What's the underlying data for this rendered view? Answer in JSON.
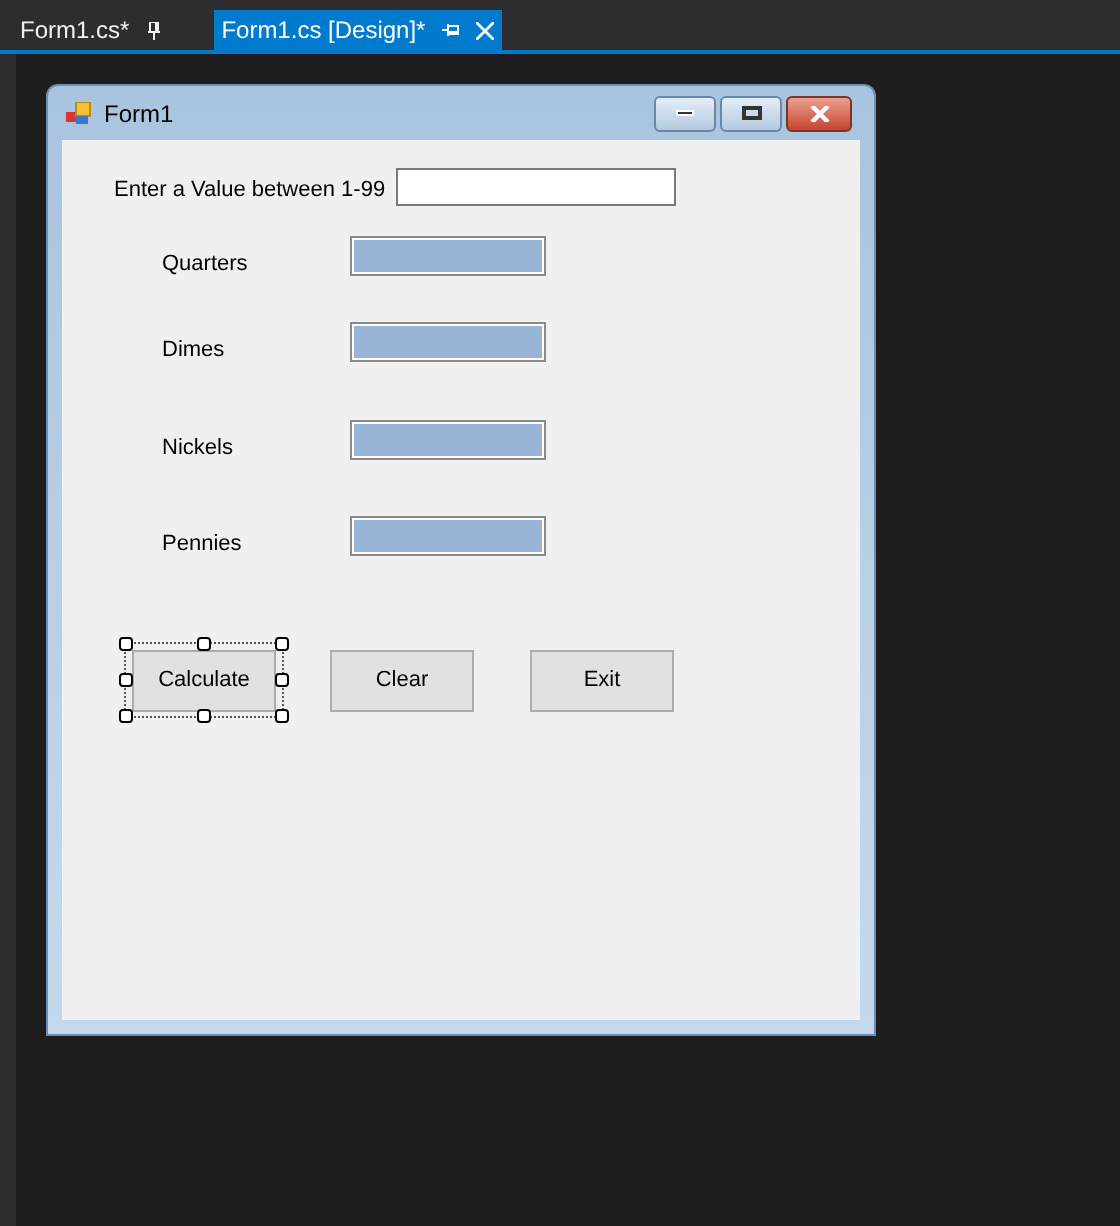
{
  "tabs": [
    {
      "label": "Form1.cs*",
      "selected": false,
      "closable": false
    },
    {
      "label": "Form1.cs [Design]*",
      "selected": true,
      "closable": true
    }
  ],
  "form": {
    "title": "Form1",
    "prompt": {
      "label": "Enter a Value between 1-99"
    },
    "outputs": [
      {
        "label": "Quarters"
      },
      {
        "label": "Dimes"
      },
      {
        "label": "Nickels"
      },
      {
        "label": "Pennies"
      }
    ],
    "buttons": [
      {
        "label": "Calculate",
        "selected": true
      },
      {
        "label": "Clear",
        "selected": false
      },
      {
        "label": "Exit",
        "selected": false
      }
    ]
  }
}
